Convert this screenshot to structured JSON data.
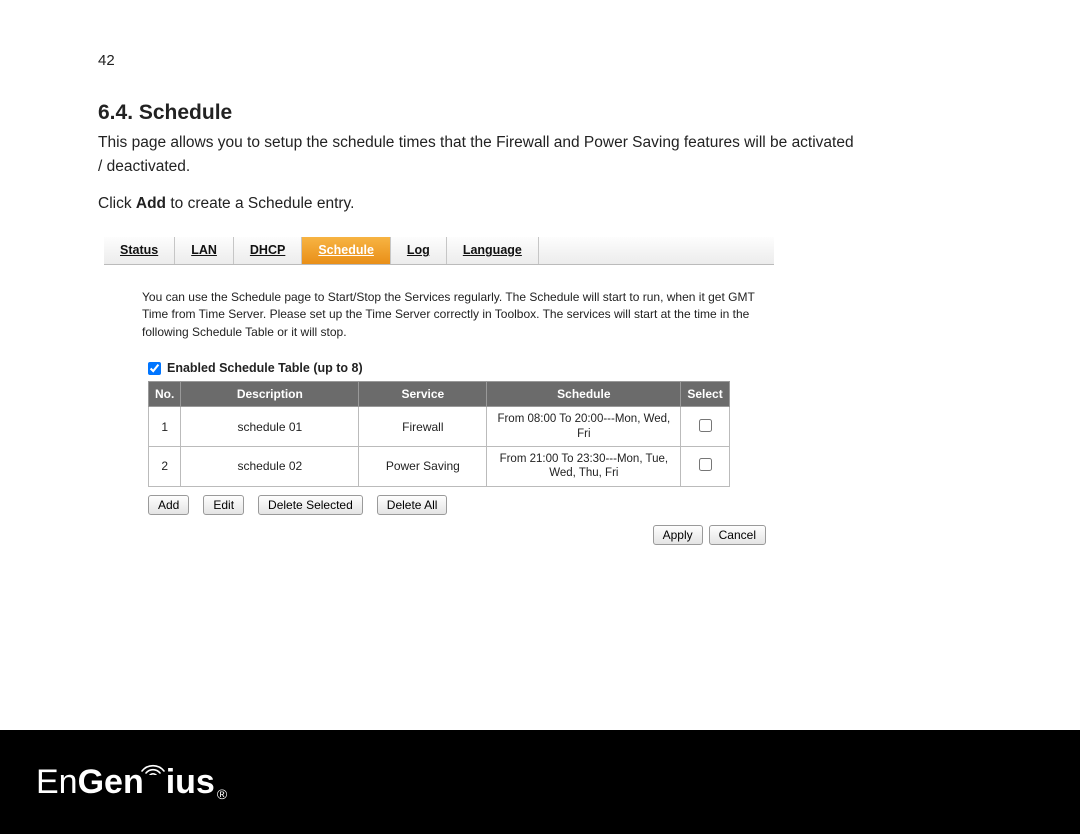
{
  "page_number": "42",
  "heading": "6.4. Schedule",
  "intro": "This page allows you to setup the schedule times that the Firewall and Power Saving features will be activated / deactivated.",
  "instruction_prefix": "Click ",
  "instruction_bold": "Add",
  "instruction_suffix": " to create a Schedule entry.",
  "tabs": {
    "status": "Status",
    "lan": "LAN",
    "dhcp": "DHCP",
    "schedule": "Schedule",
    "log": "Log",
    "language": "Language"
  },
  "panel_description": "You can use the Schedule page to Start/Stop the Services regularly. The Schedule will start to run, when it get GMT Time from Time Server. Please set up the Time Server correctly in Toolbox. The services will start at the time in the following Schedule Table or it will stop.",
  "enable_label": "Enabled Schedule Table (up to 8)",
  "columns": {
    "no": "No.",
    "description": "Description",
    "service": "Service",
    "schedule": "Schedule",
    "select": "Select"
  },
  "rows": [
    {
      "no": "1",
      "description": "schedule 01",
      "service": "Firewall",
      "schedule": "From 08:00 To 20:00---Mon, Wed, Fri"
    },
    {
      "no": "2",
      "description": "schedule 02",
      "service": "Power Saving",
      "schedule": "From 21:00 To 23:30---Mon, Tue, Wed, Thu, Fri"
    }
  ],
  "buttons": {
    "add": "Add",
    "edit": "Edit",
    "delete_selected": "Delete Selected",
    "delete_all": "Delete All",
    "apply": "Apply",
    "cancel": "Cancel"
  },
  "logo": {
    "part1": "En",
    "part2": "Gen",
    "part3": "ius",
    "reg": "®"
  }
}
